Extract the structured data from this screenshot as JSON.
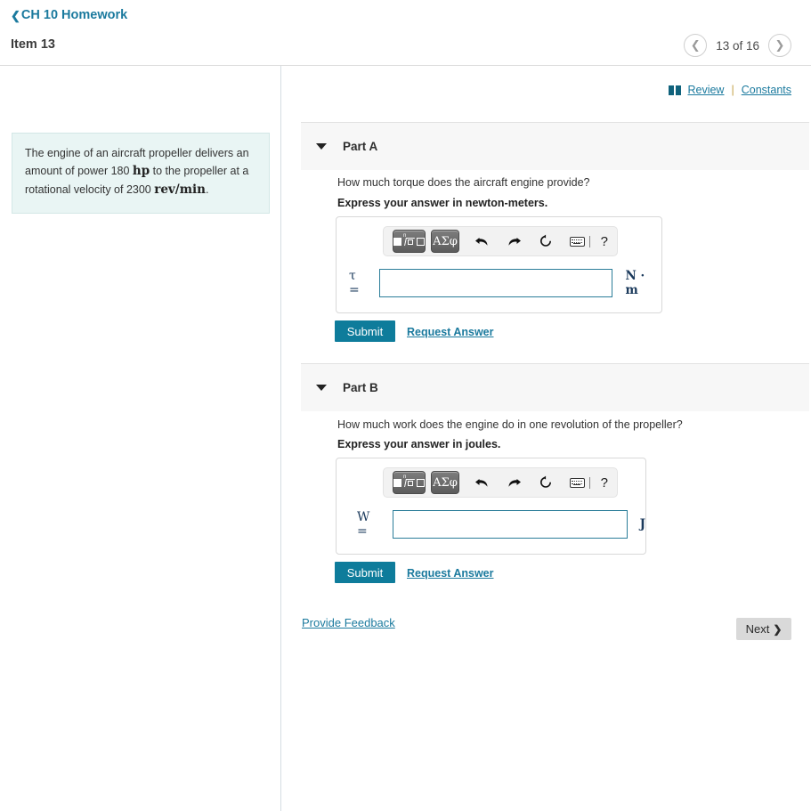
{
  "header": {
    "breadcrumb_label": "CH 10 Homework",
    "back_icon": "chevron-left-icon",
    "item_title": "Item 13",
    "pager": {
      "prev_icon": "chevron-left-icon",
      "next_icon": "chevron-right-icon",
      "position_label": "13 of 16"
    }
  },
  "sidebar": {
    "problem": {
      "line1": "The engine of an aircraft propeller delivers an",
      "line2_pre": "amount of power 180 ",
      "line2_unit": "hp",
      "line2_post": " to the propeller at a",
      "line3_pre": "rotational velocity of 2300 ",
      "line3_unit": "rev/min",
      "line3_post": "."
    }
  },
  "main": {
    "tools": {
      "book_icon": "book-icon",
      "review_label": "Review",
      "separator": "|",
      "constants_label": "Constants"
    },
    "parts": [
      {
        "caret_icon": "caret-down-icon",
        "label": "Part A",
        "question": "How much torque does the aircraft engine provide?",
        "instruction": "Express your answer in newton-meters.",
        "variable": "τ =",
        "value": "",
        "unit": "N · m",
        "submit_label": "Submit",
        "request_label": "Request Answer"
      },
      {
        "caret_icon": "caret-down-icon",
        "label": "Part B",
        "question": "How much work does the engine do in one revolution of the propeller?",
        "instruction": "Express your answer in joules.",
        "variable": "W =",
        "value": "",
        "unit": "J",
        "submit_label": "Submit",
        "request_label": "Request Answer"
      }
    ],
    "toolbar": {
      "template_button": "math-template-button",
      "greek_label": "ΑΣφ",
      "undo_icon": "undo-arrow-icon",
      "redo_icon": "redo-arrow-icon",
      "reset_icon": "reset-circular-arrow-icon",
      "keyboard_icon": "keyboard-icon",
      "help_label": "?"
    },
    "footer": {
      "feedback_label": "Provide Feedback",
      "next_label": "Next",
      "next_icon": "chevron-right-icon"
    }
  },
  "colors": {
    "accent_teal": "#0e7c9b",
    "link_blue": "#1b7a9e",
    "problem_bg": "#e9f5f4",
    "part_header_bg": "#f7f7f7",
    "next_button_bg": "#d9d9d9"
  }
}
